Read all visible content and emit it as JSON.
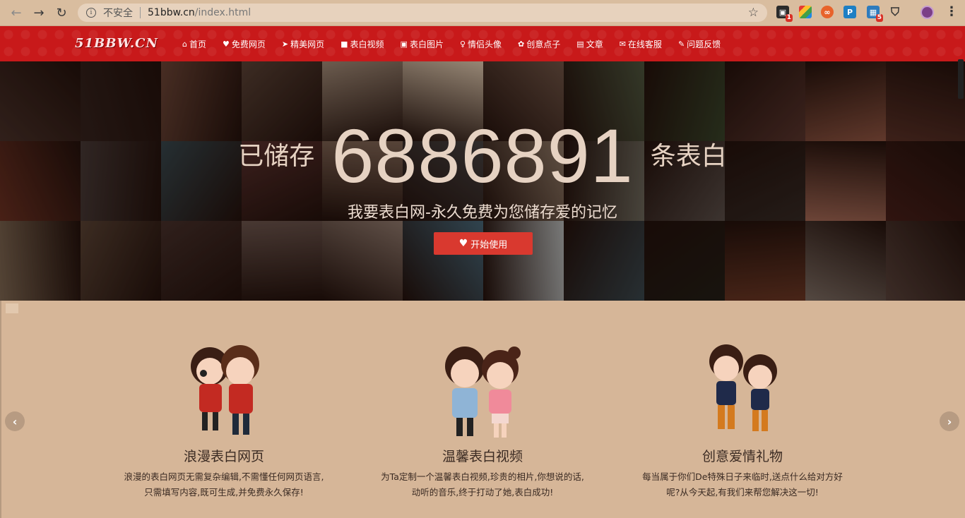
{
  "browser": {
    "insecure_label": "不安全",
    "url_host": "51bbw.cn",
    "url_path": "/index.html",
    "ext_badge_1": "1",
    "ext_badge_2": "5"
  },
  "site": {
    "logo": "51BBW.CN",
    "menu": [
      {
        "icon": "home-icon",
        "glyph": "⌂",
        "label": "首页"
      },
      {
        "icon": "heart-icon",
        "glyph": "♥",
        "label": "免费网页"
      },
      {
        "icon": "send-icon",
        "glyph": "➤",
        "label": "精美网页"
      },
      {
        "icon": "video-icon",
        "glyph": "■",
        "label": "表白视频"
      },
      {
        "icon": "picture-icon",
        "glyph": "▣",
        "label": "表白图片"
      },
      {
        "icon": "couple-icon",
        "glyph": "♀",
        "label": "情侣头像"
      },
      {
        "icon": "flower-icon",
        "glyph": "✿",
        "label": "创意点子"
      },
      {
        "icon": "book-icon",
        "glyph": "▤",
        "label": "文章"
      },
      {
        "icon": "chat-icon",
        "glyph": "✉",
        "label": "在线客服"
      },
      {
        "icon": "edit-icon",
        "glyph": "✎",
        "label": "问题反馈"
      }
    ]
  },
  "hero": {
    "prefix": "已储存",
    "count": "6886891",
    "suffix": "条表白",
    "tagline": "我要表白网-永久免费为您储存爱的记忆",
    "start_button": "开始使用"
  },
  "features": [
    {
      "title": "浪漫表白网页",
      "desc_line1": "浪漫的表白网页无需复杂编辑,不需懂任何网页语言,",
      "desc_line2": "只需填写内容,既可生成,并免费永久保存!"
    },
    {
      "title": "温馨表白视频",
      "desc_line1": "为Ta定制一个温馨表白视频,珍贵的相片,你想说的话,",
      "desc_line2": "动听的音乐,终于打动了她,表白成功!"
    },
    {
      "title": "创意爱情礼物",
      "desc_line1": "每当属于你们De特殊日子来临时,送点什么给对方好",
      "desc_line2": "呢?从今天起,有我们来帮您解决这一切!"
    }
  ],
  "colors": {
    "nav_red": "#c8191a",
    "button_red": "#d9392f",
    "page_bg": "#d6b698"
  }
}
